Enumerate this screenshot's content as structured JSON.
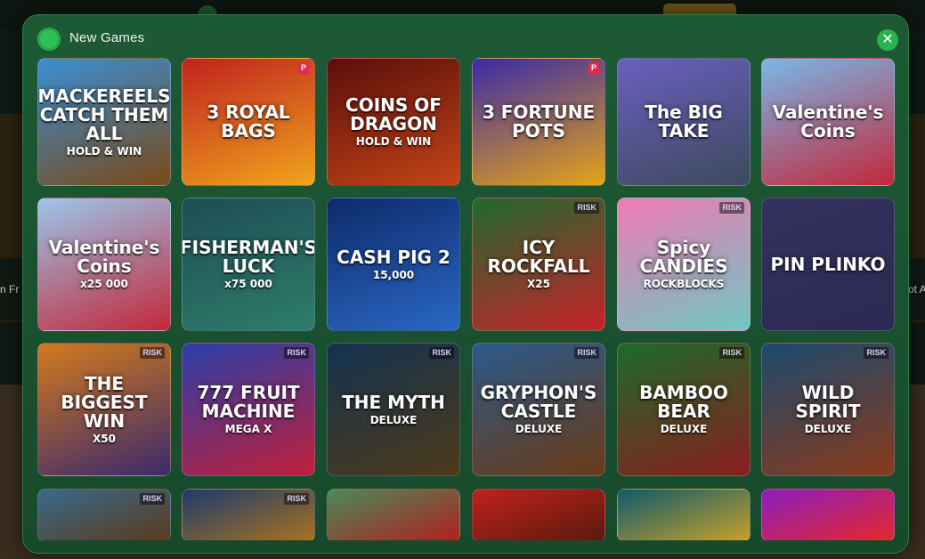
{
  "background": {
    "left_text": "n Fr",
    "right_text": "ot A"
  },
  "modal": {
    "title": "New Games",
    "close_glyph": "✕"
  },
  "games": [
    {
      "name": "MACKEREELS CATCH THEM ALL",
      "sub": "HOLD & WIN",
      "badge": "",
      "colors": [
        "#3a8fd4",
        "#7a4a18"
      ]
    },
    {
      "name": "3 ROYAL BAGS",
      "sub": "",
      "badge": "P",
      "colors": [
        "#c0221f",
        "#f0a51c"
      ]
    },
    {
      "name": "COINS OF DRAGON",
      "sub": "HOLD & WIN",
      "badge": "",
      "colors": [
        "#5a0f0c",
        "#c44416"
      ]
    },
    {
      "name": "3 FORTUNE POTS",
      "sub": "",
      "badge": "P",
      "colors": [
        "#3b2aa8",
        "#e6a317"
      ]
    },
    {
      "name": "The BIG TAKE",
      "sub": "",
      "badge": "",
      "colors": [
        "#6a5fbf",
        "#3d4a5c"
      ]
    },
    {
      "name": "Valentine's Coins",
      "sub": "",
      "badge": "",
      "colors": [
        "#79b7e8",
        "#c2283a"
      ]
    },
    {
      "name": "Valentine's Coins",
      "sub": "x25 000",
      "badge": "",
      "colors": [
        "#9cc6ea",
        "#c2283a"
      ]
    },
    {
      "name": "FISHERMAN'S LUCK",
      "sub": "x75 000",
      "badge": "",
      "colors": [
        "#1d4d55",
        "#2f7d6a"
      ]
    },
    {
      "name": "CASH PIG 2",
      "sub": "15,000",
      "badge": "",
      "colors": [
        "#0f2a6b",
        "#2a68c4"
      ]
    },
    {
      "name": "ICY ROCKFALL",
      "sub": "X25",
      "badge": "RISK",
      "colors": [
        "#1f6a2e",
        "#c8222a"
      ]
    },
    {
      "name": "Spicy CANDIES",
      "sub": "ROCKBLOCKS",
      "badge": "RISK",
      "colors": [
        "#f07ab5",
        "#6fc7c0"
      ]
    },
    {
      "name": "PIN PLINKO",
      "sub": "",
      "badge": "",
      "colors": [
        "#34325e",
        "#2b2a52"
      ]
    },
    {
      "name": "THE BIGGEST WIN",
      "sub": "X50",
      "badge": "RISK",
      "colors": [
        "#d27a1e",
        "#3b2a6b"
      ]
    },
    {
      "name": "777 FRUIT MACHINE",
      "sub": "MEGA X",
      "badge": "RISK",
      "colors": [
        "#2a3fa8",
        "#c01f3a"
      ]
    },
    {
      "name": "THE MYTH",
      "sub": "DELUXE",
      "badge": "RISK",
      "colors": [
        "#14334f",
        "#4d3a1a"
      ]
    },
    {
      "name": "GRYPHON'S CASTLE",
      "sub": "DELUXE",
      "badge": "RISK",
      "colors": [
        "#2a5a8a",
        "#6b3a16"
      ]
    },
    {
      "name": "BAMBOO BEAR",
      "sub": "DELUXE",
      "badge": "RISK",
      "colors": [
        "#1d6a2a",
        "#8a1e1e"
      ]
    },
    {
      "name": "WILD SPIRIT",
      "sub": "DELUXE",
      "badge": "RISK",
      "colors": [
        "#1c4a6e",
        "#8a3a1a"
      ]
    },
    {
      "name": "",
      "sub": "",
      "badge": "RISK",
      "colors": [
        "#3a6a8a",
        "#5a3a1a"
      ]
    },
    {
      "name": "",
      "sub": "",
      "badge": "RISK",
      "colors": [
        "#1e3a6e",
        "#a8731e"
      ]
    },
    {
      "name": "",
      "sub": "",
      "badge": "",
      "colors": [
        "#4a8a5a",
        "#b0201e"
      ]
    },
    {
      "name": "",
      "sub": "",
      "badge": "",
      "colors": [
        "#c0221f",
        "#5a1a0c"
      ]
    },
    {
      "name": "",
      "sub": "",
      "badge": "",
      "colors": [
        "#0f5a6b",
        "#c8a12a"
      ]
    },
    {
      "name": "",
      "sub": "",
      "badge": "",
      "colors": [
        "#8a1ec0",
        "#e6282a"
      ]
    }
  ]
}
